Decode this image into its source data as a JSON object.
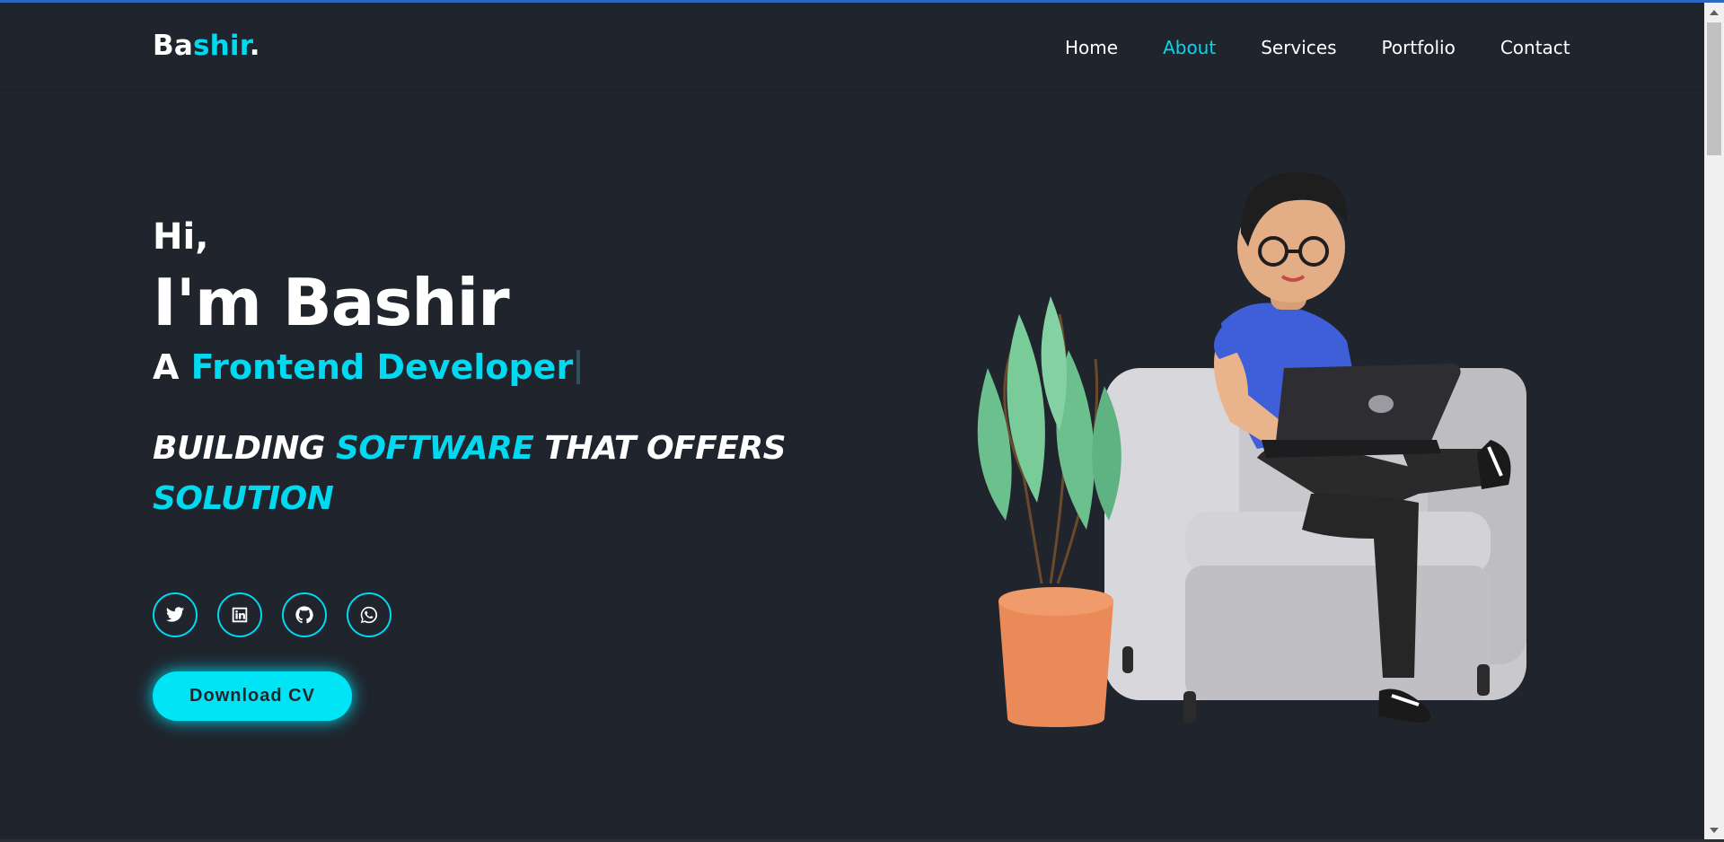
{
  "header": {
    "logo_part1": "Ba",
    "logo_part2": "shir",
    "logo_dot": ".",
    "nav": [
      "Home",
      "About",
      "Services",
      "Portfolio",
      "Contact"
    ],
    "active_nav": "About"
  },
  "hero": {
    "greeting": "Hi,",
    "name": "I'm Bashir",
    "role_prefix": "A ",
    "role": "Frontend Developer",
    "tagline_1": "BUILDING ",
    "tagline_2": "SOFTWARE",
    "tagline_3": " THAT OFFERS",
    "tagline_4": "SOLUTION"
  },
  "socials": [
    "twitter-icon",
    "linkedin-icon",
    "github-icon",
    "whatsapp-icon"
  ],
  "cta": {
    "download_label": "Download CV"
  },
  "colors": {
    "background": "#1f242d",
    "accent": "#00d9f0",
    "text": "#ffffff"
  }
}
